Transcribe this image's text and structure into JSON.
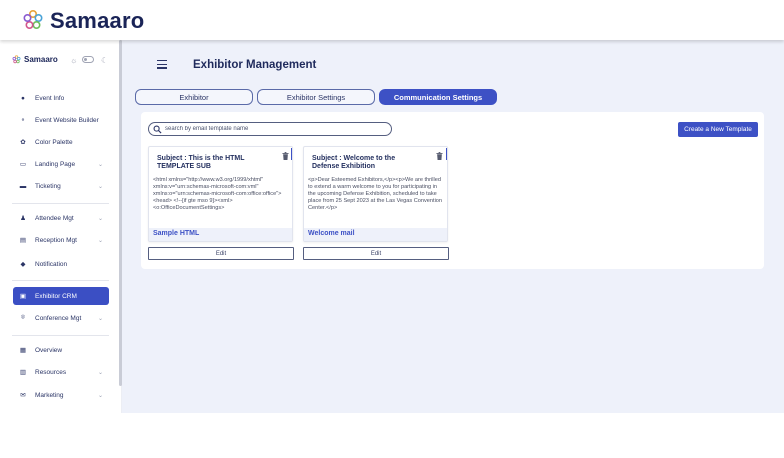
{
  "app": {
    "brand": "Samaaro"
  },
  "sidebar": {
    "brand": "Samaaro",
    "items": [
      {
        "label": "Event Info",
        "icon": "info-icon",
        "glyph": "●",
        "has_chevron": false,
        "active": false
      },
      {
        "label": "Event Website Builder",
        "icon": "website-builder-icon",
        "glyph": "⚬",
        "has_chevron": false,
        "active": false
      },
      {
        "label": "Color Palette",
        "icon": "palette-icon",
        "glyph": "✿",
        "has_chevron": false,
        "active": false
      },
      {
        "label": "Landing Page",
        "icon": "landing-page-icon",
        "glyph": "▭",
        "has_chevron": true,
        "active": false
      },
      {
        "label": "Ticketing",
        "icon": "ticket-icon",
        "glyph": "▬",
        "has_chevron": true,
        "active": false
      },
      {
        "label": "Attendee Mgt",
        "icon": "attendee-icon",
        "glyph": "♟",
        "has_chevron": true,
        "active": false
      },
      {
        "label": "Reception Mgt",
        "icon": "reception-icon",
        "glyph": "▤",
        "has_chevron": true,
        "active": false
      },
      {
        "label": "Notification",
        "icon": "bell-icon",
        "glyph": "◆",
        "has_chevron": false,
        "active": false
      },
      {
        "label": "Exhibitor CRM",
        "icon": "exhibitor-icon",
        "glyph": "▣",
        "has_chevron": false,
        "active": true
      },
      {
        "label": "Conference Mgt",
        "icon": "conference-icon",
        "glyph": "⌾",
        "has_chevron": true,
        "active": false
      },
      {
        "label": "Overview",
        "icon": "overview-icon",
        "glyph": "▦",
        "has_chevron": false,
        "active": false
      },
      {
        "label": "Resources",
        "icon": "resources-icon",
        "glyph": "▥",
        "has_chevron": true,
        "active": false
      },
      {
        "label": "Marketing",
        "icon": "marketing-icon",
        "glyph": "✉",
        "has_chevron": true,
        "active": false
      }
    ]
  },
  "header": {
    "title": "Exhibitor Management"
  },
  "tabs": [
    {
      "label": "Exhibitor",
      "active": false
    },
    {
      "label": "Exhibitor Settings",
      "active": false
    },
    {
      "label": "Communication Settings",
      "active": true
    }
  ],
  "search": {
    "placeholder": "search by email template name",
    "value": ""
  },
  "toolbar": {
    "create_label": "Create a New Template"
  },
  "templates": [
    {
      "subject": "Subject : This is the HTML TEMPLATE SUB",
      "body": "<html xmlns=\"http://www.w3.org/1999/xhtml\" xmlns:v=\"urn:schemas-microsoft-com:vml\" xmlns:o=\"urn:schemas-microsoft-com:office:office\"> <head> <!--[if gte mso 9]><xml> <o:OfficeDocumentSettings>",
      "name": "Sample HTML",
      "edit_label": "Edit"
    },
    {
      "subject": "Subject : Welcome to the Defense Exhibition",
      "body": "<p>Dear Esteemed Exhibitors,</p><p>We are thrilled to extend a warm welcome to you for participating in the upcoming Defense Exhibition, scheduled to take place from 25 Sept 2023 at the Las Vegas Convention Center.</p>",
      "name": "Welcome mail",
      "edit_label": "Edit"
    }
  ],
  "colors": {
    "accent": "#3d51c5",
    "background": "#eef1fa",
    "text": "#1f2a5c"
  }
}
